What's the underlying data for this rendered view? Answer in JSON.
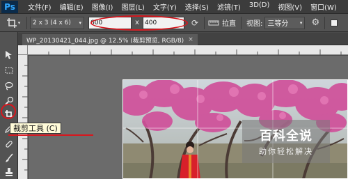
{
  "app": {
    "logo": "Ps"
  },
  "menu": [
    "文件(F)",
    "编辑(E)",
    "图像(I)",
    "图层(L)",
    "文字(Y)",
    "选择(S)",
    "滤镜(T)",
    "3D(D)",
    "视图(V)",
    "窗口(W)"
  ],
  "options": {
    "ratio_value": "2 x 3 (4 x 6)",
    "width_value": "600",
    "x_label": "x",
    "height_value": "400",
    "straighten_label": "拉直",
    "view_label": "视图:",
    "view_value": "三等分"
  },
  "document": {
    "tab_title": "WP_20130421_044.jpg @ 12.5% (裁剪预览, RGB/8)"
  },
  "tooltip": {
    "text": "裁剪工具 (C)"
  },
  "watermark": {
    "title": "百科全说",
    "subtitle": "助你轻松解决"
  },
  "colors": {
    "highlight": "#d9161d",
    "blossom": "#d0509a",
    "jacket": "#d8202a"
  },
  "icons": [
    "crop-icon",
    "rotate-icon",
    "straighten-icon",
    "gear-icon",
    "move-icon",
    "marquee-icon",
    "lasso-icon",
    "quick-select-icon",
    "eyedropper-icon",
    "healing-icon",
    "brush-icon",
    "stamp-icon"
  ]
}
